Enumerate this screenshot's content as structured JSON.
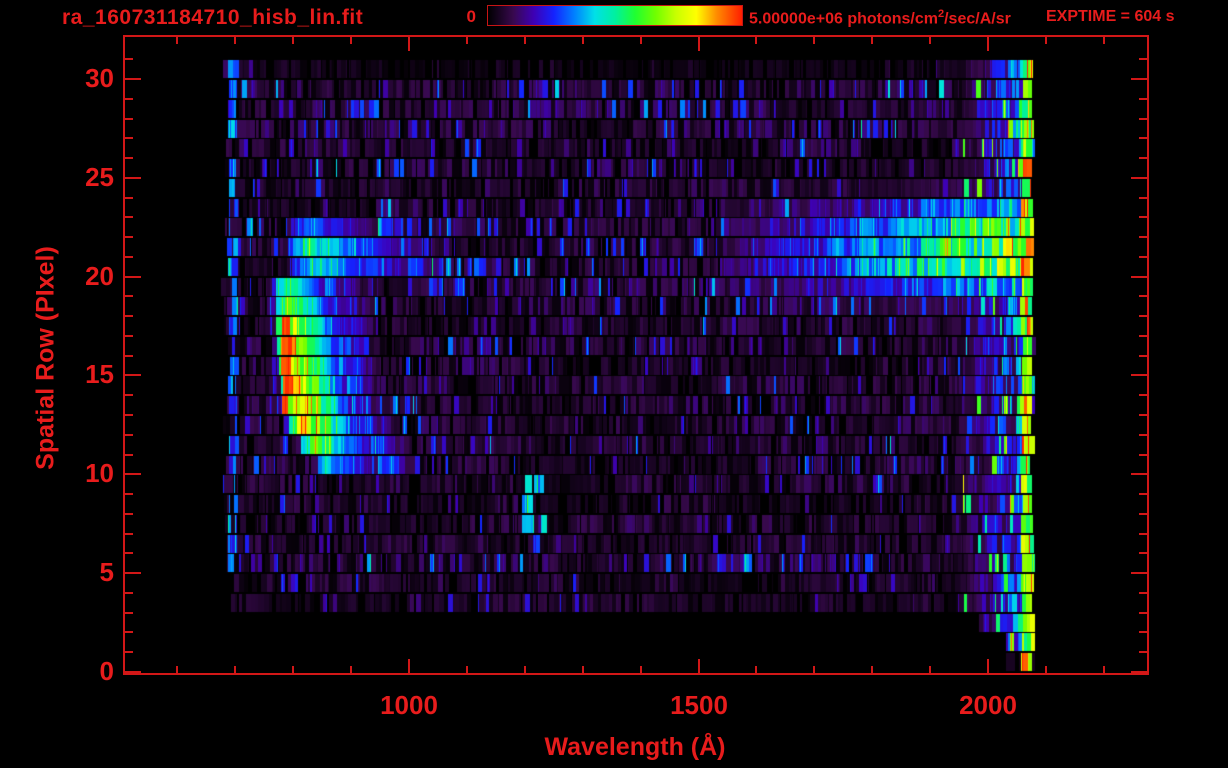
{
  "window": {
    "background": "#000000",
    "text_color": "#e81c1c",
    "axis_color": "#d21717"
  },
  "header": {
    "title": "ra_160731184710_hisb_lin.fit",
    "colorbar": {
      "min_label": "0",
      "max_label": "5.00000e+06",
      "units_prefix": " photons/cm",
      "units_sup": "2",
      "units_suffix": "/sec/A/sr"
    },
    "exptime": "EXPTIME = 604 s"
  },
  "chart_data": {
    "type": "heatmap",
    "title": "ra_160731184710_hisb_lin.fit",
    "xlabel": "Wavelength (Å)",
    "ylabel": "Spatial Row (PIxel)",
    "xlim": [
      508,
      2275
    ],
    "ylim": [
      0,
      32.2
    ],
    "x_ticks": [
      1000,
      1500,
      2000
    ],
    "x_minor_ticks": [
      600,
      700,
      800,
      900,
      1100,
      1200,
      1300,
      1400,
      1600,
      1700,
      1800,
      1900,
      2100,
      2200
    ],
    "y_ticks": [
      0,
      5,
      10,
      15,
      20,
      25,
      30
    ],
    "y_minor_step": 1,
    "colorbar_min": 0,
    "colorbar_max": 5000000,
    "colorbar_max_label": "5.00000e+06",
    "units": "photons/cm^2/sec/A/sr",
    "exposure_seconds": 604,
    "colormap_stops": [
      {
        "pos": 0.0,
        "color": "#000000"
      },
      {
        "pos": 0.1,
        "color": "#38094e"
      },
      {
        "pos": 0.18,
        "color": "#3e00b4"
      },
      {
        "pos": 0.26,
        "color": "#1423ff"
      },
      {
        "pos": 0.34,
        "color": "#0080ff"
      },
      {
        "pos": 0.42,
        "color": "#00e0e8"
      },
      {
        "pos": 0.5,
        "color": "#00f0a0"
      },
      {
        "pos": 0.58,
        "color": "#20ff30"
      },
      {
        "pos": 0.66,
        "color": "#70ff00"
      },
      {
        "pos": 0.74,
        "color": "#c8ff00"
      },
      {
        "pos": 0.82,
        "color": "#ffff00"
      },
      {
        "pos": 0.9,
        "color": "#ff8c00"
      },
      {
        "pos": 1.0,
        "color": "#ff1e00"
      }
    ],
    "data_extent": {
      "wavelength_min": 675,
      "wavelength_max": 2078,
      "row_min": 0,
      "row_max": 31
    },
    "seed": 20160731,
    "band_profiles": [
      [
        0.55,
        0.05
      ],
      [
        0.6,
        0.06
      ],
      [
        0.55,
        0.05
      ],
      [
        0.6,
        0.05
      ],
      [
        0.7,
        0.06
      ],
      [
        0.85,
        0.1
      ],
      [
        0.7,
        0.07
      ],
      [
        0.75,
        0.07
      ],
      [
        0.7,
        0.07
      ],
      [
        0.8,
        0.08
      ],
      [
        0.85,
        0.08
      ],
      [
        0.9,
        0.08
      ],
      [
        0.85,
        0.08
      ],
      [
        0.9,
        0.08
      ],
      [
        0.9,
        0.08
      ],
      [
        0.85,
        0.08
      ],
      [
        0.9,
        0.08
      ],
      [
        0.9,
        0.09
      ],
      [
        0.95,
        0.1
      ],
      [
        1.0,
        0.14
      ],
      [
        1.0,
        0.15
      ],
      [
        1.0,
        0.15
      ],
      [
        1.0,
        0.14
      ],
      [
        0.95,
        0.12
      ],
      [
        0.8,
        0.08
      ],
      [
        0.9,
        0.1
      ],
      [
        0.85,
        0.1
      ],
      [
        0.9,
        0.1
      ],
      [
        1.0,
        0.12
      ],
      [
        1.0,
        0.13
      ],
      [
        0.4,
        0.05
      ],
      [
        0.0,
        0.0
      ]
    ],
    "features": [
      {
        "name": "airglow-arc",
        "type": "arc",
        "halo": 70,
        "segments": [
          [
            10,
            840,
            945,
            0.42
          ],
          [
            11,
            812,
            935,
            0.62
          ],
          [
            12,
            795,
            912,
            0.85
          ],
          [
            13,
            783,
            897,
            0.9
          ],
          [
            14,
            779,
            887,
            0.92
          ],
          [
            15,
            776,
            882,
            0.9
          ],
          [
            16,
            773,
            876,
            0.86
          ],
          [
            17,
            772,
            878,
            0.8
          ],
          [
            18,
            771,
            872,
            0.7
          ],
          [
            19,
            770,
            856,
            0.58
          ]
        ]
      },
      {
        "name": "arc-hot-edge",
        "type": "vline",
        "lambda": [
          781,
          795
        ],
        "rows": [
          13,
          17
        ],
        "value": [
          0.93,
          0.99
        ],
        "prob": 1.0
      },
      {
        "name": "upper-left-streak",
        "type": "arc",
        "halo": 40,
        "segments": [
          [
            20,
            800,
            1005,
            0.42
          ],
          [
            21,
            792,
            985,
            0.5
          ],
          [
            22,
            800,
            948,
            0.3
          ]
        ]
      },
      {
        "name": "red-continuum-band",
        "type": "continuum",
        "lambda_start": 1540,
        "lambda_end": 2076,
        "row_weights": {
          "18": 0.2,
          "19": 0.6,
          "20": 1.0,
          "21": 1.0,
          "22": 0.85,
          "23": 0.5,
          "24": 0.15
        }
      },
      {
        "name": "right-bright-zone",
        "type": "right_zone",
        "lambda_start": 1935,
        "lambda_end": 2076,
        "rows": [
          1,
          30
        ]
      },
      {
        "name": "terminal-edge",
        "type": "terminal",
        "lambda": [
          2058,
          2078
        ],
        "rows": [
          0,
          30
        ],
        "value": [
          0.5,
          0.8
        ],
        "hot_prob": 0.07
      },
      {
        "name": "left-blue-line",
        "type": "vline",
        "lambda": [
          689,
          703
        ],
        "rows": [
          5,
          31
        ],
        "value": [
          0.2,
          0.42
        ],
        "prob": 0.8
      },
      {
        "name": "lya-speck",
        "type": "patch",
        "lambda": [
          1195,
          1235
        ],
        "rows": [
          6,
          9
        ],
        "value": [
          0.28,
          0.46
        ],
        "prob": 0.45
      }
    ]
  }
}
